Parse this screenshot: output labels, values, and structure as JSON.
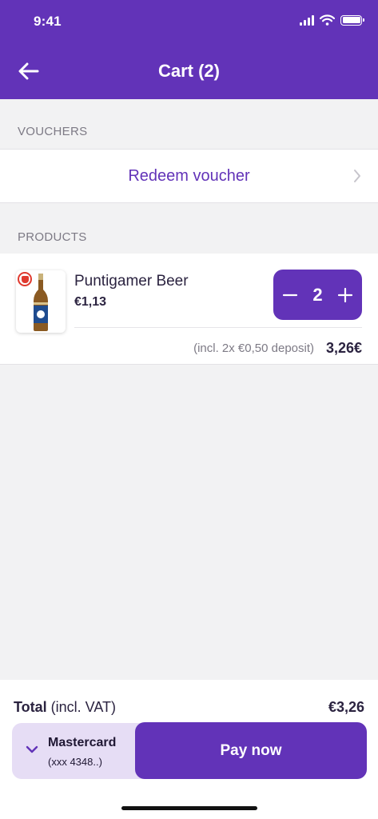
{
  "status_bar": {
    "time": "9:41"
  },
  "header": {
    "title": "Cart (2)"
  },
  "vouchers": {
    "section_label": "VOUCHERS",
    "redeem_label": "Redeem voucher"
  },
  "products": {
    "section_label": "PRODUCTS",
    "items": [
      {
        "name": "Puntigamer Beer",
        "price": "€1,13",
        "quantity": "2",
        "deposit_note": "(incl. 2x €0,50 deposit)",
        "line_total": "3,26€"
      }
    ]
  },
  "footer": {
    "total_label": "Total",
    "total_suffix": " (incl. VAT)",
    "total_value": "€3,26",
    "payment_method": {
      "name": "Mastercard",
      "number": "(xxx 4348..)"
    },
    "pay_label": "Pay now"
  },
  "colors": {
    "brand": "#6233b8",
    "age_badge": "#e03a2f",
    "payment_bg": "#e6ddf5"
  },
  "icons": {
    "back": "arrow-left-icon",
    "voucher": "chevron-right-icon",
    "age": "hand-stop-icon",
    "payment": "chevron-down-icon"
  }
}
